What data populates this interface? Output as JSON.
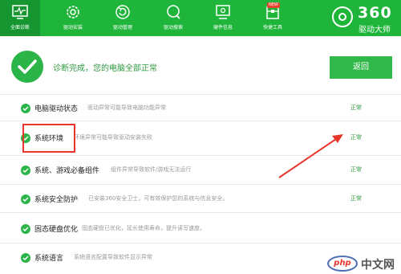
{
  "toolbar": {
    "tabs": [
      {
        "label": "全面诊断",
        "icon": "monitor-pulse-icon"
      },
      {
        "label": "驱动安装",
        "icon": "gear-icon"
      },
      {
        "label": "驱动管理",
        "icon": "refresh-circle-icon"
      },
      {
        "label": "驱动搜索",
        "icon": "search-icon"
      },
      {
        "label": "硬件信息",
        "icon": "computer-info-icon"
      },
      {
        "label": "快捷工具",
        "icon": "toolbox-icon"
      }
    ],
    "new_badge": "NEW",
    "brand_number": "360",
    "brand_name": "驱动大师"
  },
  "summary": {
    "message": "诊断完成，您的电脑全部正常",
    "return_button": "返回"
  },
  "rows": [
    {
      "name": "电脑驱动状态",
      "desc": "驱动异常可能导致电脑功能异常",
      "status": "正常"
    },
    {
      "name": "系统环境",
      "desc": "环境异常可能导致驱动安装失败",
      "status": "正常"
    },
    {
      "name": "系统、游戏必备组件",
      "desc": "组件异常导致软件/游戏无法运行",
      "status": "正常"
    },
    {
      "name": "系统安全防护",
      "desc": "已安装360安全卫士，可有效保护您的系统与信息安全。",
      "status": "正常"
    },
    {
      "name": "固态硬盘优化",
      "desc": "固态硬盘已优化，延长使用寿命，提升读写速度。",
      "status": ""
    },
    {
      "name": "系统语言",
      "desc": "系统语言配置导致软件显示异常",
      "status": ""
    }
  ],
  "watermark": {
    "logo": "php",
    "text": "中文网"
  },
  "colors": {
    "brand_green": "#1eb53a",
    "status_green": "#2e9a3f",
    "highlight_red": "#e8362c"
  }
}
